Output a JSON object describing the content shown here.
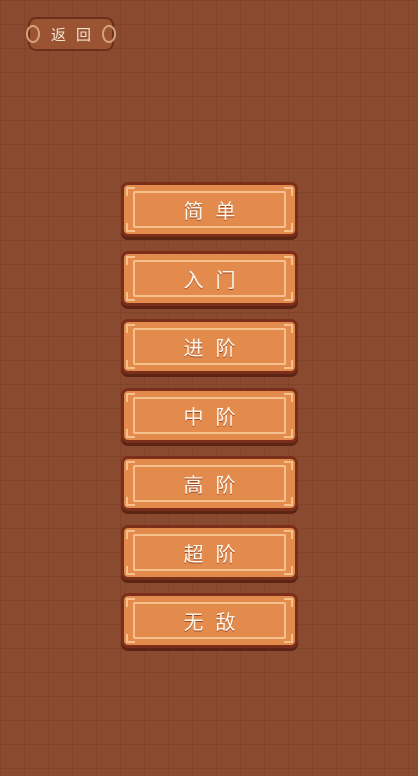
{
  "header": {
    "back_label": "返回"
  },
  "levels": [
    "简单",
    "入门",
    "进阶",
    "中阶",
    "高阶",
    "超阶",
    "无敌"
  ]
}
